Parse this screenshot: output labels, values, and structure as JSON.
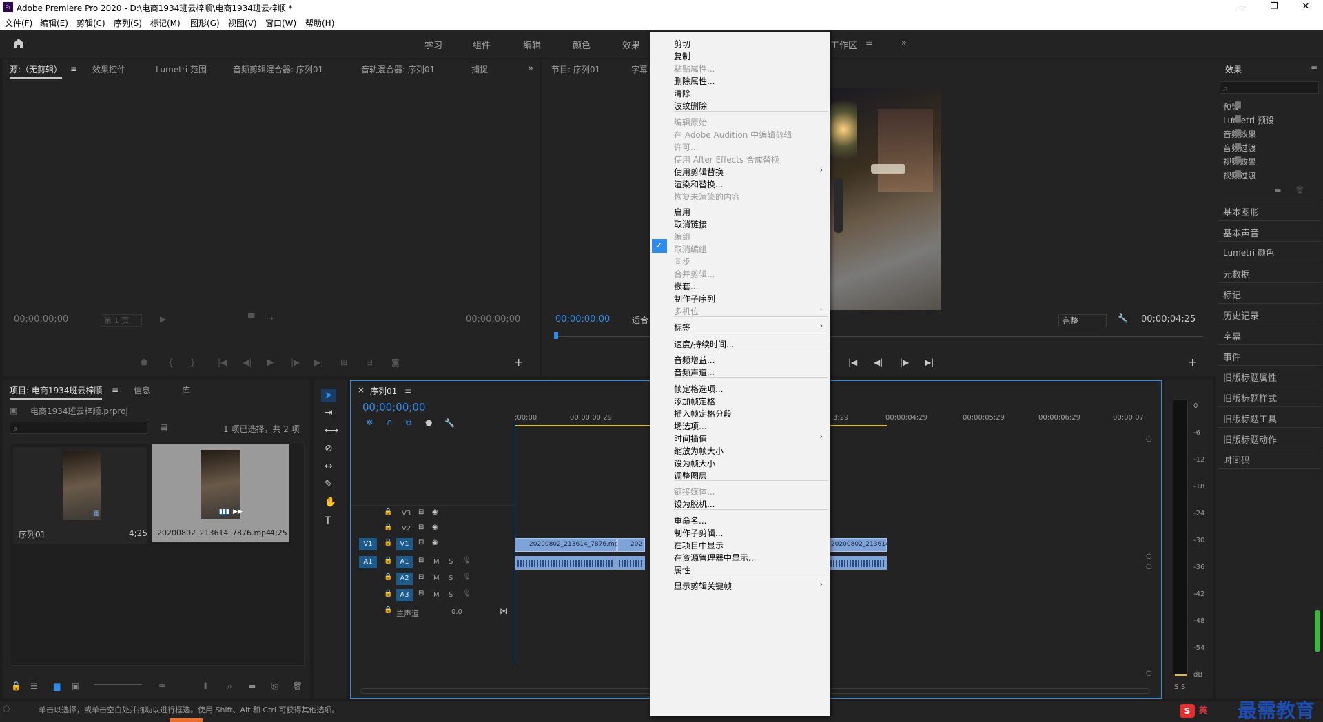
{
  "app": {
    "title": "Adobe Premiere Pro 2020 - D:\\电商1934班云梓顺\\电商1934班云梓顺 *",
    "logo": "Pr"
  },
  "window_controls": {
    "minimize": "─",
    "restore": "❐",
    "close": "✕"
  },
  "menu": [
    "文件(F)",
    "编辑(E)",
    "剪辑(C)",
    "序列(S)",
    "标记(M)",
    "图形(G)",
    "视图(V)",
    "窗口(W)",
    "帮助(H)"
  ],
  "workspaces": {
    "tabs": [
      "学习",
      "组件",
      "编辑",
      "颜色",
      "效果"
    ],
    "visible_tail": "工作区",
    "more": "»"
  },
  "source_panel": {
    "tabs": [
      "源:（无剪辑）",
      "效果控件",
      "Lumetri 范围",
      "音频剪辑混合器: 序列01",
      "音轨混合器: 序列01",
      "捕捉"
    ],
    "timecode_left": "00;00;00;00",
    "page_label": "第 1 页",
    "timecode_right": "00;00;00;00",
    "more": "»",
    "add": "+"
  },
  "program_panel": {
    "tabs": [
      "节目: 序列01",
      "字幕"
    ],
    "timecode": "00;00;00;00",
    "fit_label": "适合",
    "quality": "完整",
    "duration": "00;00;04;25",
    "add": "+"
  },
  "project_panel": {
    "tabs": [
      "项目: 电商1934班云梓顺",
      "信息",
      "库"
    ],
    "file": "电商1934班云梓顺.prproj",
    "selection_info": "1 项已选择，共 2 项",
    "items": [
      {
        "name": "序列01",
        "duration": "4;25"
      },
      {
        "name": "20200802_213614_7876.mp4",
        "duration": "4;25"
      }
    ]
  },
  "timeline": {
    "tab": "序列01",
    "timecode": "00;00;00;00",
    "ruler": [
      ";00;00",
      "00;00;00;29",
      "3;29",
      "00;00;04;29",
      "00;00;05;29",
      "00;00;06;29",
      "00;00;07;"
    ],
    "tracks_video": [
      "V3",
      "V2",
      "V1"
    ],
    "tracks_audio": [
      "A1",
      "A2",
      "A3"
    ],
    "master": {
      "label": "主声道",
      "value": "0.0"
    },
    "clips": [
      "20200802_213614_7876.mp",
      "202",
      "20200802_213614_"
    ],
    "mute": "M",
    "solo": "S"
  },
  "tools": [
    "selection-tool",
    "track-select-tool",
    "ripple-edit-tool",
    "razor-tool",
    "slip-tool",
    "pen-tool",
    "hand-tool",
    "type-tool"
  ],
  "effects_panel": {
    "title": "效果",
    "tree": [
      "预设",
      "Lumetri 预设",
      "音频效果",
      "音频过渡",
      "视频效果",
      "视频过渡"
    ],
    "panels": [
      "基本图形",
      "基本声音",
      "Lumetri 颜色",
      "元数据",
      "标记",
      "历史记录",
      "字幕",
      "事件",
      "旧版标题属性",
      "旧版标题样式",
      "旧版标题工具",
      "旧版标题动作",
      "时间码"
    ]
  },
  "audio_meter": {
    "scale": [
      "0",
      "-6",
      "-12",
      "-18",
      "-24",
      "-30",
      "-36",
      "-42",
      "-48",
      "-54",
      "dB"
    ],
    "solo": [
      "S",
      "S"
    ]
  },
  "context_menu": {
    "items": [
      {
        "label": "剪切",
        "enabled": true
      },
      {
        "label": "复制",
        "enabled": true
      },
      {
        "label": "粘贴属性...",
        "enabled": false
      },
      {
        "label": "删除属性...",
        "enabled": true
      },
      {
        "label": "清除",
        "enabled": true
      },
      {
        "label": "波纹删除",
        "enabled": true
      },
      {
        "label": "编辑原始",
        "enabled": false
      },
      {
        "label": "在 Adobe Audition 中编辑剪辑",
        "enabled": false
      },
      {
        "label": "许可...",
        "enabled": false
      },
      {
        "label": "使用 After Effects 合成替换",
        "enabled": false
      },
      {
        "label": "使用剪辑替换",
        "enabled": true,
        "submenu": true
      },
      {
        "label": "渲染和替换...",
        "enabled": true
      },
      {
        "label": "恢复未渲染的内容",
        "enabled": false
      },
      {
        "label": "启用",
        "enabled": true,
        "checked": true
      },
      {
        "label": "取消链接",
        "enabled": true
      },
      {
        "label": "编组",
        "enabled": false
      },
      {
        "label": "取消编组",
        "enabled": false
      },
      {
        "label": "同步",
        "enabled": false
      },
      {
        "label": "合并剪辑...",
        "enabled": false
      },
      {
        "label": "嵌套...",
        "enabled": true
      },
      {
        "label": "制作子序列",
        "enabled": true
      },
      {
        "label": "多机位",
        "enabled": false,
        "submenu": true
      },
      {
        "label": "标签",
        "enabled": true,
        "submenu": true
      },
      {
        "label": "速度/持续时间...",
        "enabled": true
      },
      {
        "label": "音频增益...",
        "enabled": true
      },
      {
        "label": "音频声道...",
        "enabled": true
      },
      {
        "label": "帧定格选项...",
        "enabled": true
      },
      {
        "label": "添加帧定格",
        "enabled": true
      },
      {
        "label": "插入帧定格分段",
        "enabled": true
      },
      {
        "label": "场选项...",
        "enabled": true
      },
      {
        "label": "时间插值",
        "enabled": true,
        "submenu": true
      },
      {
        "label": "缩放为帧大小",
        "enabled": true
      },
      {
        "label": "设为帧大小",
        "enabled": true
      },
      {
        "label": "调整图层",
        "enabled": true
      },
      {
        "label": "链接媒体...",
        "enabled": false
      },
      {
        "label": "设为脱机...",
        "enabled": true
      },
      {
        "label": "重命名...",
        "enabled": true
      },
      {
        "label": "制作子剪辑...",
        "enabled": true
      },
      {
        "label": "在项目中显示",
        "enabled": true
      },
      {
        "label": "在资源管理器中显示...",
        "enabled": true
      },
      {
        "label": "属性",
        "enabled": true
      },
      {
        "label": "显示剪辑关键帧",
        "enabled": true,
        "submenu": true
      }
    ],
    "check_mark": "✓",
    "submenu_arrow": "›"
  },
  "status_bar": {
    "text": "单击以选择，或单击空白处并拖动以进行框选。使用 Shift、Alt 和 Ctrl 可获得其他选项。"
  },
  "watermark": {
    "text": "最需教育",
    "ime": "英"
  },
  "colors": {
    "accent_blue": "#2d8ceb",
    "clip_blue": "#7ea3d8",
    "menu_bg": "#f2f2f2",
    "panel_bg": "#232323"
  }
}
